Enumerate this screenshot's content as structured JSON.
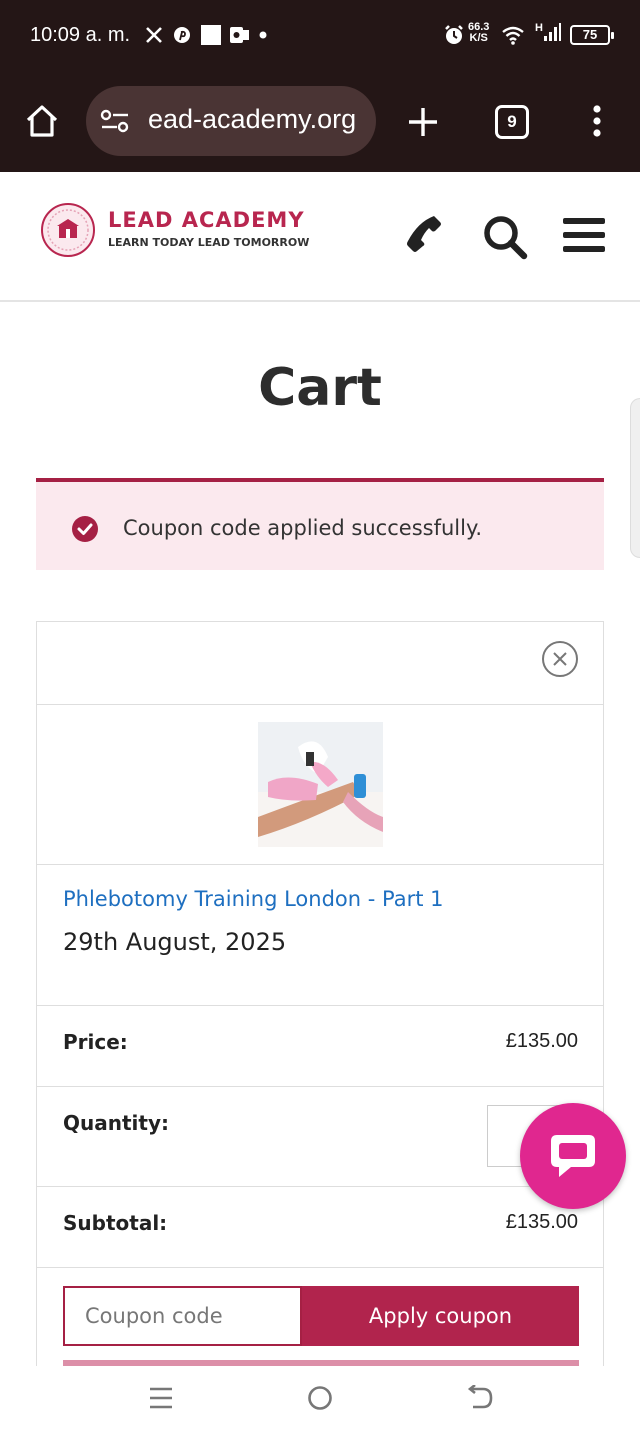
{
  "status_bar": {
    "time": "10:09 a. m.",
    "speed_value": "66.3",
    "speed_unit": "K/S",
    "network": "H",
    "battery": "75"
  },
  "browser": {
    "url": "ead-academy.org",
    "tab_count": "9"
  },
  "site": {
    "brand_name": "LEAD ACADEMY",
    "tagline": "LEARN TODAY LEAD TOMORROW"
  },
  "page": {
    "title": "Cart"
  },
  "notice": {
    "message": "Coupon code applied successfully."
  },
  "cart": {
    "product_name": "Phlebotomy Training London - Part 1",
    "product_date": "29th August, 2025",
    "price_label": "Price:",
    "price_value": "£135.00",
    "quantity_label": "Quantity:",
    "subtotal_label": "Subtotal:",
    "subtotal_value": "£135.00",
    "coupon_placeholder": "Coupon code",
    "apply_label": "Apply coupon"
  },
  "colors": {
    "brand": "#b8264f",
    "accent": "#a52044",
    "chat": "#e0278f",
    "link": "#1e6fc0"
  }
}
